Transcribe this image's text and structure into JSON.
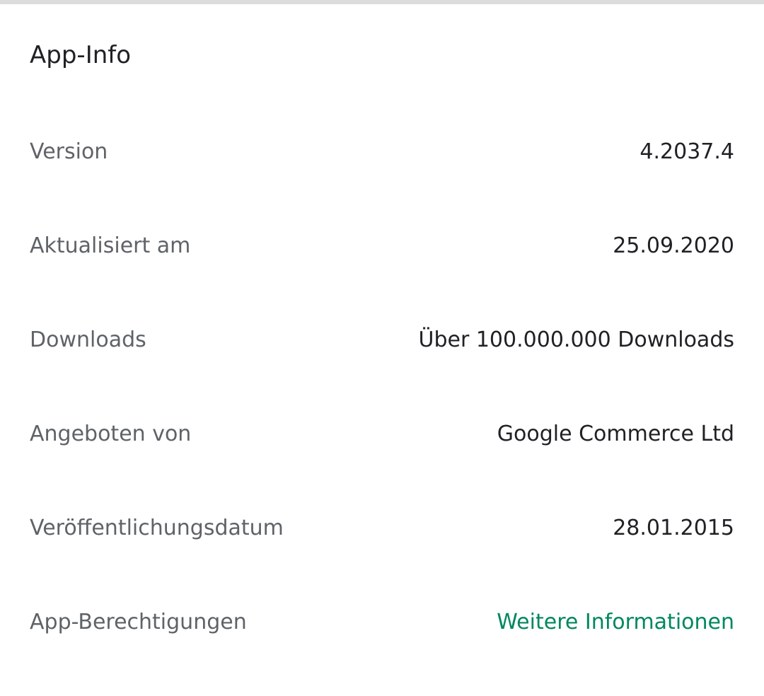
{
  "section": {
    "title": "App-Info"
  },
  "rows": [
    {
      "label": "Version",
      "value": "4.2037.4"
    },
    {
      "label": "Aktualisiert am",
      "value": "25.09.2020"
    },
    {
      "label": "Downloads",
      "value": "Über 100.000.000 Downloads"
    },
    {
      "label": "Angeboten von",
      "value": "Google Commerce Ltd"
    },
    {
      "label": "Veröffentlichungsdatum",
      "value": "28.01.2015"
    },
    {
      "label": "App-Berechtigungen",
      "value": "Weitere Informationen"
    }
  ],
  "colors": {
    "link": "#01875f",
    "label": "#5f6368",
    "value": "#202124"
  }
}
